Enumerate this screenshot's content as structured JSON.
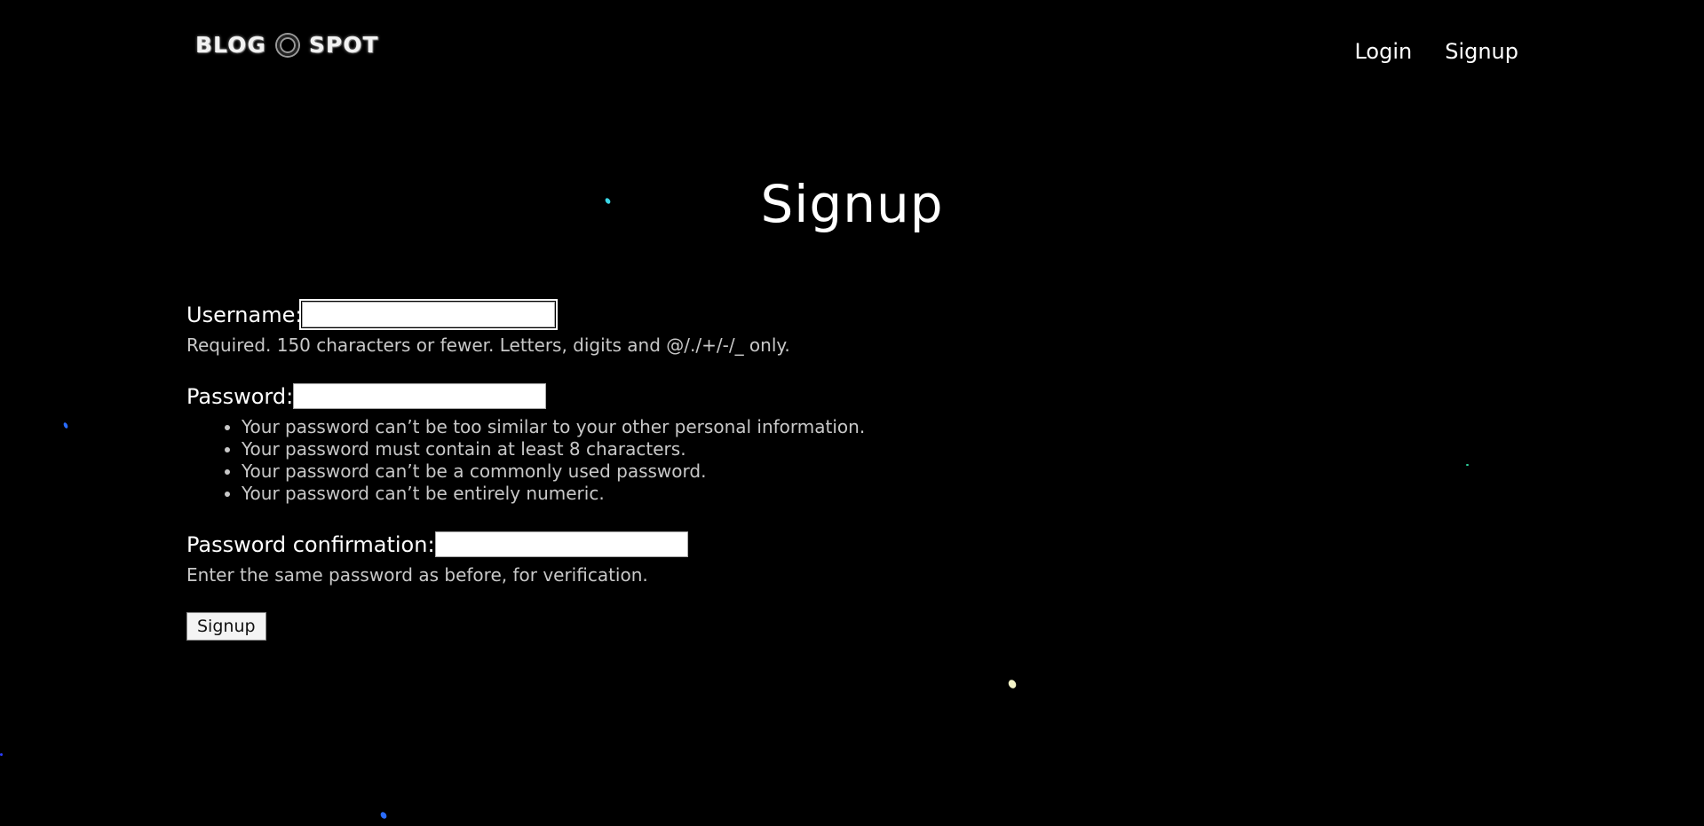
{
  "header": {
    "logo_left": "BLOG",
    "logo_right": "SPOT",
    "nav": {
      "login_label": "Login",
      "signup_label": "Signup"
    }
  },
  "main": {
    "title": "Signup",
    "form": {
      "username": {
        "label": "Username:",
        "value": "",
        "help": "Required. 150 characters or fewer. Letters, digits and @/./+/-/_ only."
      },
      "password": {
        "label": "Password:",
        "value": "",
        "rules": [
          "Your password can’t be too similar to your other personal information.",
          "Your password must contain at least 8 characters.",
          "Your password can’t be a commonly used password.",
          "Your password can’t be entirely numeric."
        ]
      },
      "password_confirmation": {
        "label": "Password confirmation:",
        "value": "",
        "help": "Enter the same password as before, for verification."
      },
      "submit_label": "Signup"
    }
  },
  "colors": {
    "background": "#000000",
    "text": "#ffffff",
    "help_text": "#c8c8c8"
  }
}
